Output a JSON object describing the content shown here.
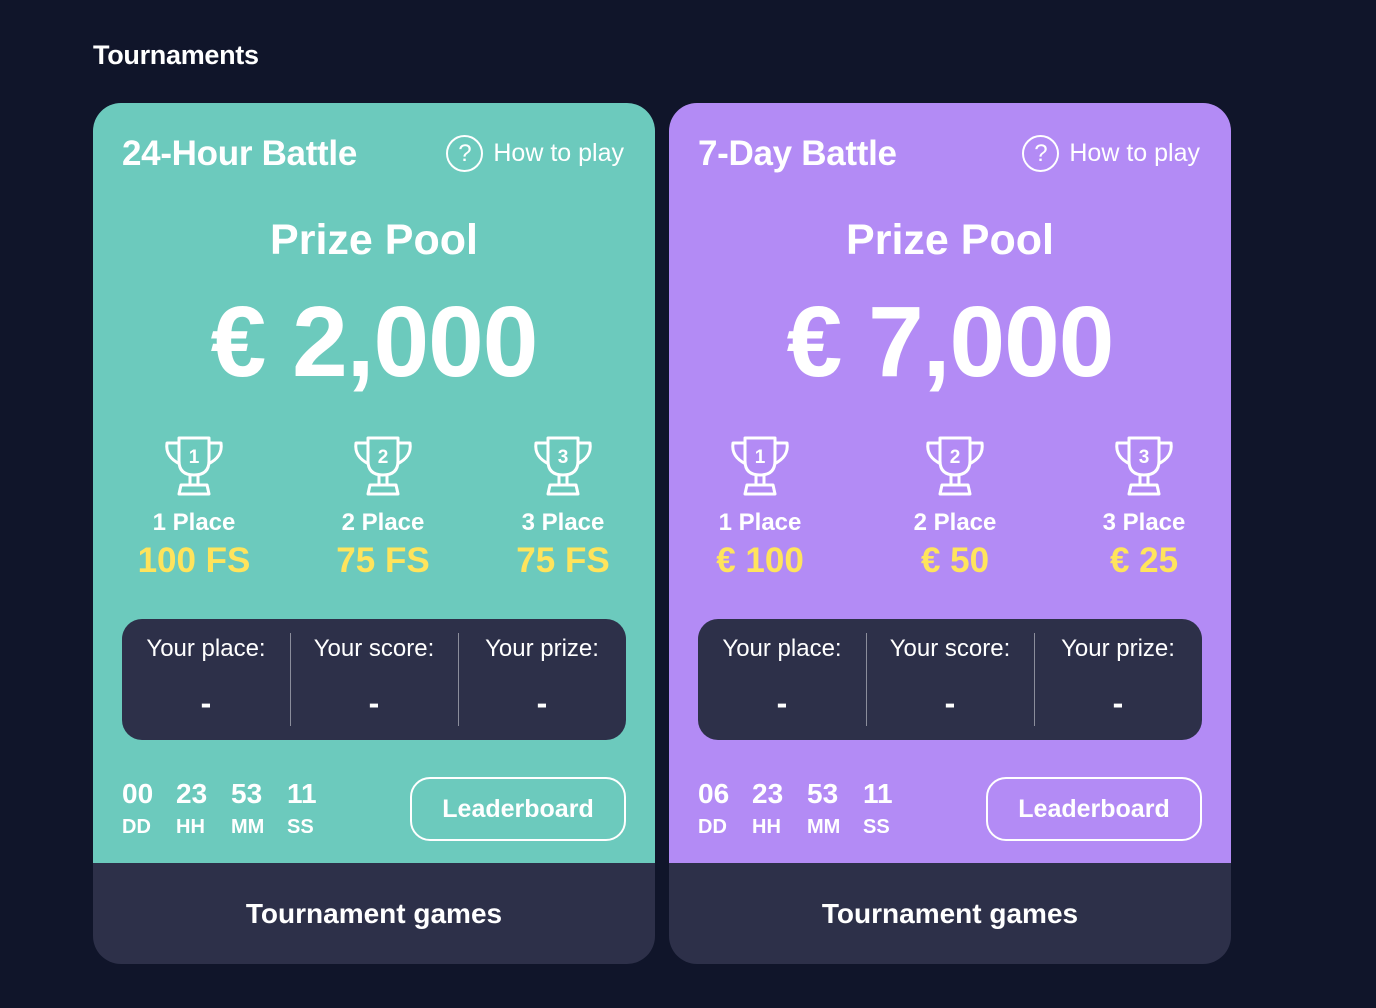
{
  "page": {
    "title": "Tournaments"
  },
  "colors": {
    "background": "#10152a",
    "card1": "#6ccabd",
    "card2": "#b38bf5",
    "panel": "#2d3049",
    "prize_accent": "#ffe45c"
  },
  "cards": [
    {
      "title": "24-Hour Battle",
      "how_to_play": "How to play",
      "help_icon": "?",
      "prize_label": "Prize Pool",
      "prize_amount": "€ 2,000",
      "places": [
        {
          "rank": "1",
          "label": "1 Place",
          "prize": "100 FS"
        },
        {
          "rank": "2",
          "label": "2 Place",
          "prize": "75 FS"
        },
        {
          "rank": "3",
          "label": "3 Place",
          "prize": "75 FS"
        }
      ],
      "stats": [
        {
          "label": "Your place:",
          "value": "-"
        },
        {
          "label": "Your score:",
          "value": "-"
        },
        {
          "label": "Your prize:",
          "value": "-"
        }
      ],
      "countdown": [
        {
          "value": "00",
          "unit": "DD"
        },
        {
          "value": "23",
          "unit": "HH"
        },
        {
          "value": "53",
          "unit": "MM"
        },
        {
          "value": "11",
          "unit": "SS"
        }
      ],
      "leaderboard_label": "Leaderboard",
      "games_label": "Tournament games"
    },
    {
      "title": "7-Day Battle",
      "how_to_play": "How to play",
      "help_icon": "?",
      "prize_label": "Prize Pool",
      "prize_amount": "€ 7,000",
      "places": [
        {
          "rank": "1",
          "label": "1 Place",
          "prize": "€ 100"
        },
        {
          "rank": "2",
          "label": "2 Place",
          "prize": "€ 50"
        },
        {
          "rank": "3",
          "label": "3 Place",
          "prize": "€ 25"
        }
      ],
      "stats": [
        {
          "label": "Your place:",
          "value": "-"
        },
        {
          "label": "Your score:",
          "value": "-"
        },
        {
          "label": "Your prize:",
          "value": "-"
        }
      ],
      "countdown": [
        {
          "value": "06",
          "unit": "DD"
        },
        {
          "value": "23",
          "unit": "HH"
        },
        {
          "value": "53",
          "unit": "MM"
        },
        {
          "value": "11",
          "unit": "SS"
        }
      ],
      "leaderboard_label": "Leaderboard",
      "games_label": "Tournament games"
    }
  ]
}
